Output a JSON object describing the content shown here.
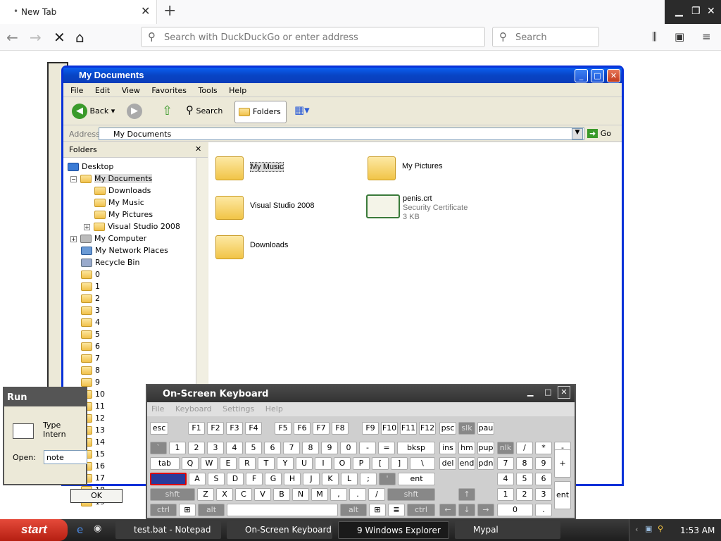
{
  "browser": {
    "tab_title": "New Tab",
    "url_placeholder": "Search with DuckDuckGo or enter address",
    "search_placeholder": "Search"
  },
  "explorer": {
    "title": "My Documents",
    "menu": [
      "File",
      "Edit",
      "View",
      "Favorites",
      "Tools",
      "Help"
    ],
    "toolbar": {
      "back": "Back",
      "search": "Search",
      "folders": "Folders"
    },
    "address_label": "Address",
    "address_value": "My Documents",
    "go": "Go",
    "folders_header": "Folders",
    "tree": [
      "Desktop",
      "My Documents",
      "Downloads",
      "My Music",
      "My Pictures",
      "Visual Studio 2008",
      "My Computer",
      "My Network Places",
      "Recycle Bin",
      "0",
      "1",
      "2",
      "3",
      "4",
      "5",
      "6",
      "7",
      "8",
      "9",
      "10",
      "11",
      "12",
      "13",
      "14",
      "15",
      "16",
      "17",
      "18",
      "19"
    ],
    "items": [
      {
        "label": "My Music"
      },
      {
        "label": "My Pictures"
      },
      {
        "label": "Visual Studio 2008"
      },
      {
        "label": "penis.crt",
        "sub1": "Security Certificate",
        "sub2": "3 KB"
      },
      {
        "label": "Downloads"
      }
    ]
  },
  "osk": {
    "title": "On-Screen Keyboard",
    "menu": [
      "File",
      "Keyboard",
      "Settings",
      "Help"
    ]
  },
  "run": {
    "title": "Run",
    "type_text": "Type",
    "type_text2": "Intern",
    "open_label": "Open:",
    "open_value": "note",
    "ok": "OK"
  },
  "taskbar": {
    "start": "start",
    "tasks": [
      "test.bat - Notepad",
      "On-Screen Keyboard",
      "9 Windows Explorer",
      "Mypal"
    ],
    "clock": "1:53 AM"
  }
}
